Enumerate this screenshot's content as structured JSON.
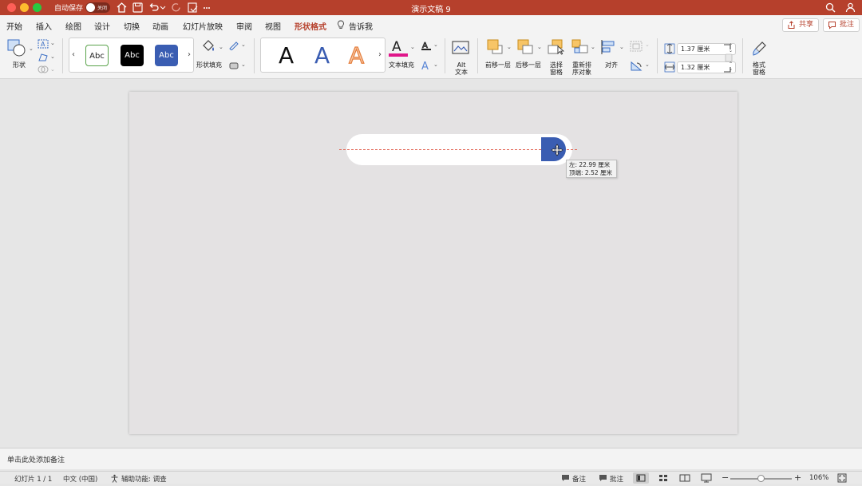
{
  "titlebar": {
    "autosave_label": "自动保存",
    "autosave_state": "关闭",
    "doc_title": "演示文稿 9"
  },
  "tabs": [
    {
      "label": "开始"
    },
    {
      "label": "插入"
    },
    {
      "label": "绘图"
    },
    {
      "label": "设计"
    },
    {
      "label": "切换"
    },
    {
      "label": "动画"
    },
    {
      "label": "幻灯片放映"
    },
    {
      "label": "审阅"
    },
    {
      "label": "视图"
    },
    {
      "label": "形状格式",
      "active": true
    },
    {
      "label": "告诉我"
    }
  ],
  "header_buttons": {
    "share": "共享",
    "comments": "批注"
  },
  "ribbon": {
    "shapes_label": "形状",
    "shape_styles": [
      "Abc",
      "Abc",
      "Abc"
    ],
    "shape_fill_label": "形状填充",
    "wordart_letters": [
      "A",
      "A",
      "A"
    ],
    "text_fill_label": "文本填充",
    "alt_text_line1": "Alt",
    "alt_text_line2": "文本",
    "bring_forward": "前移一层",
    "send_backward": "后移一层",
    "selection_pane_line1": "选择",
    "selection_pane_line2": "窗格",
    "reorder_line1": "重新排",
    "reorder_line2": "序对象",
    "align": "对齐",
    "height_value": "1.37 厘米",
    "width_value": "1.32 厘米",
    "format_pane_line1": "格式",
    "format_pane_line2": "窗格"
  },
  "slide": {
    "tooltip_left": "左: 22.99 厘米",
    "tooltip_top": "顶端: 2.52 厘米"
  },
  "notes": {
    "placeholder": "单击此处添加备注"
  },
  "statusbar": {
    "slide_counter": "幻灯片 1 / 1",
    "language": "中文 (中国)",
    "accessibility": "辅助功能: 调查",
    "notes_button": "备注",
    "comments_button": "批注",
    "zoom_percent": "106%",
    "zoom_fraction": 0.5
  },
  "colors": {
    "accent": "#b6402c",
    "shape_blue": "#3a5db2",
    "text_fill_underline": "#e0168a"
  }
}
